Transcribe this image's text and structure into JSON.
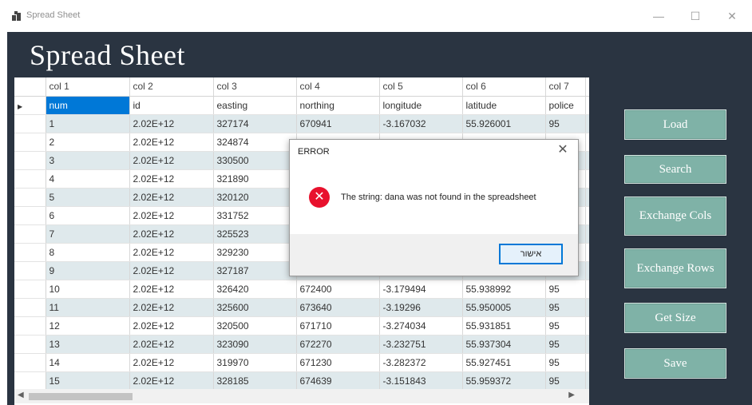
{
  "window": {
    "title": "Spread Sheet",
    "minimize": "—",
    "maximize": "☐",
    "close": "✕"
  },
  "app": {
    "heading": "Spread Sheet"
  },
  "grid": {
    "columns": [
      "col 1",
      "col 2",
      "col 3",
      "col 4",
      "col 5",
      "col 6",
      "col 7"
    ],
    "rows": [
      [
        "num",
        "id",
        "easting",
        "northing",
        "longitude",
        "latitude",
        "police"
      ],
      [
        "1",
        "2.02E+12",
        "327174",
        "670941",
        "-3.167032",
        "55.926001",
        "95"
      ],
      [
        "2",
        "2.02E+12",
        "324874",
        "",
        "",
        "",
        ""
      ],
      [
        "3",
        "2.02E+12",
        "330500",
        "",
        "",
        "",
        ""
      ],
      [
        "4",
        "2.02E+12",
        "321890",
        "",
        "",
        "",
        ""
      ],
      [
        "5",
        "2.02E+12",
        "320120",
        "",
        "",
        "",
        ""
      ],
      [
        "6",
        "2.02E+12",
        "331752",
        "",
        "",
        "",
        ""
      ],
      [
        "7",
        "2.02E+12",
        "325523",
        "",
        "",
        "",
        ""
      ],
      [
        "8",
        "2.02E+12",
        "329230",
        "",
        "",
        "",
        ""
      ],
      [
        "9",
        "2.02E+12",
        "327187",
        "",
        "",
        "",
        ""
      ],
      [
        "10",
        "2.02E+12",
        "326420",
        "672400",
        "-3.179494",
        "55.938992",
        "95"
      ],
      [
        "11",
        "2.02E+12",
        "325600",
        "673640",
        "-3.19296",
        "55.950005",
        "95"
      ],
      [
        "12",
        "2.02E+12",
        "320500",
        "671710",
        "-3.274034",
        "55.931851",
        "95"
      ],
      [
        "13",
        "2.02E+12",
        "323090",
        "672270",
        "-3.232751",
        "55.937304",
        "95"
      ],
      [
        "14",
        "2.02E+12",
        "319970",
        "671230",
        "-3.282372",
        "55.927451",
        "95"
      ],
      [
        "15",
        "2.02E+12",
        "328185",
        "674639",
        "-3.151843",
        "55.959372",
        "95"
      ]
    ],
    "current_row_marker": "▶"
  },
  "buttons": {
    "load": "Load",
    "search": "Search",
    "exchange_cols": "Exchange Cols",
    "exchange_rows": "Exchange Rows",
    "get_size": "Get Size",
    "save": "Save"
  },
  "dialog": {
    "title": "ERROR",
    "close": "✕",
    "icon": "✕",
    "message": "The string: dana was not found in the spreadsheet",
    "ok": "אישור"
  },
  "colors": {
    "background": "#2a3441",
    "button": "#7fb2a7",
    "alt_row": "#dfe9ec",
    "selection": "#0078d7",
    "error": "#e8112d"
  }
}
